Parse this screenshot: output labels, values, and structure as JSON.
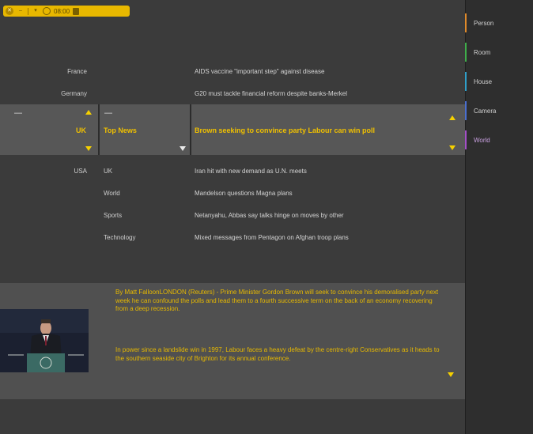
{
  "toolbar": {
    "time": "08:00"
  },
  "countries": [
    "France",
    "Germany",
    "UK",
    "USA"
  ],
  "selected": {
    "country": "UK",
    "category": "Top News",
    "headline": "Brown seeking to convince party Labour can win poll"
  },
  "categories": [
    "UK",
    "World",
    "Sports",
    "Technology"
  ],
  "headlines": {
    "above": [
      "AIDS vaccine \"important step\" against disease",
      "G20 must tackle financial reform despite banks-Merkel"
    ],
    "below": [
      "Iran hit with new demand as U.N. meets",
      "Mandelson questions Magna plans",
      "Netanyahu, Abbas say talks hinge on moves by other",
      "Mixed messages from Pentagon on Afghan troop plans"
    ]
  },
  "article": {
    "para1": "By Matt FalloonLONDON (Reuters) - Prime Minister Gordon Brown will seek to convince his demoralised party next week he can confound the polls and lead them to a fourth successive term on the back of an economy recovering from a deep recession.",
    "para2": "In power since a landslide win in 1997, Labour faces a heavy defeat by the centre-right Conservatives as it heads to the southern seaside city of Brighton for its annual conference."
  },
  "sidebar": {
    "items": [
      {
        "label": "Person",
        "color": "#e08a2a"
      },
      {
        "label": "Room",
        "color": "#3fae4a"
      },
      {
        "label": "House",
        "color": "#2f9fc9"
      },
      {
        "label": "Camera",
        "color": "#4a6fd0"
      },
      {
        "label": "World",
        "color": "#a44fc8"
      }
    ]
  },
  "colors": {
    "accent": "#f0c000",
    "band": "#575757",
    "background": "#3b3b3b"
  }
}
